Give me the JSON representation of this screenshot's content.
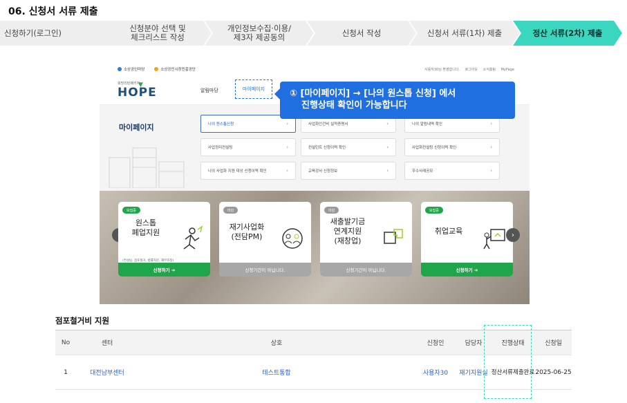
{
  "page_title": "06. 신청서 서류 제출",
  "steps": [
    {
      "label": "신청하기(로그인)"
    },
    {
      "label": "신청분야 선택 및\n체크리스트 작성"
    },
    {
      "label": "개인정보수집·이용/\n제3자 제공동의"
    },
    {
      "label": "신청서 작성"
    },
    {
      "label": "신청서 서류(1차) 제출"
    },
    {
      "label": "정산 서류(2차) 제출"
    }
  ],
  "colors": {
    "active_step": "#3ad6bf",
    "highlight": "#1f6fe0",
    "apply_green": "#20a64a",
    "table_link": "#2d5fb8"
  },
  "site": {
    "org1": "소상공인마당",
    "org2": "소상공인시장진흥공단",
    "top_links": [
      "사용자30님 환영합니다.",
      "로그아웃",
      "소식홈팀",
      "MyPage"
    ],
    "logo_sub": "희망리턴패키지",
    "logo": "HOPE",
    "nav_notice": "알림마당",
    "nav_mypage": "마이페이지",
    "mypage_title": "마이페이지",
    "menu": [
      "나의 원스톱신청",
      "사업화인건비 실적증명서",
      "나의 알림내역 확인",
      "사업정리컨설팅",
      "컨설턴트 신청이력 확인",
      "사업화컨설팅 신청이력 확인",
      "나의 사업화 지원 대상 신청이력 확인",
      "교육강사 신청정보",
      "우수사례공모"
    ],
    "cards": [
      {
        "badge": "모집중",
        "title": "원스톱\n폐업지원",
        "sub": "(컨설팅, 점포철거, 법률자문, 재무조정)",
        "cta": "신청하기 ➜",
        "open": true
      },
      {
        "badge": "마감",
        "title": "재기사업화\n(전담PM)",
        "sub": "",
        "cta": "신청기간이 아닙니다.",
        "open": false
      },
      {
        "badge": "마감",
        "title": "새출발기금\n연계지원\n(재창업)",
        "sub": "",
        "cta": "신청기간이 아닙니다.",
        "open": false
      },
      {
        "badge": "모집중",
        "title": "취업교육",
        "sub": "",
        "cta": "신청하기 ➜",
        "open": true
      }
    ]
  },
  "tooltip": {
    "line1": "① [마이페이지] → [나의 원스톱 신청] 에서",
    "line2": "진행상태 확인이 가능합니다"
  },
  "section_title": "점포철거비 지원",
  "table": {
    "headers": [
      "No",
      "센터",
      "상호",
      "신청인",
      "담당자",
      "진행상태",
      "신청일"
    ],
    "rows": [
      {
        "no": "1",
        "center": "대전남부센터",
        "company": "테스트통합",
        "applicant": "사용자30",
        "manager": "재기지원실",
        "status": "정산서류제출완료",
        "date": "2025-06-25"
      }
    ]
  }
}
